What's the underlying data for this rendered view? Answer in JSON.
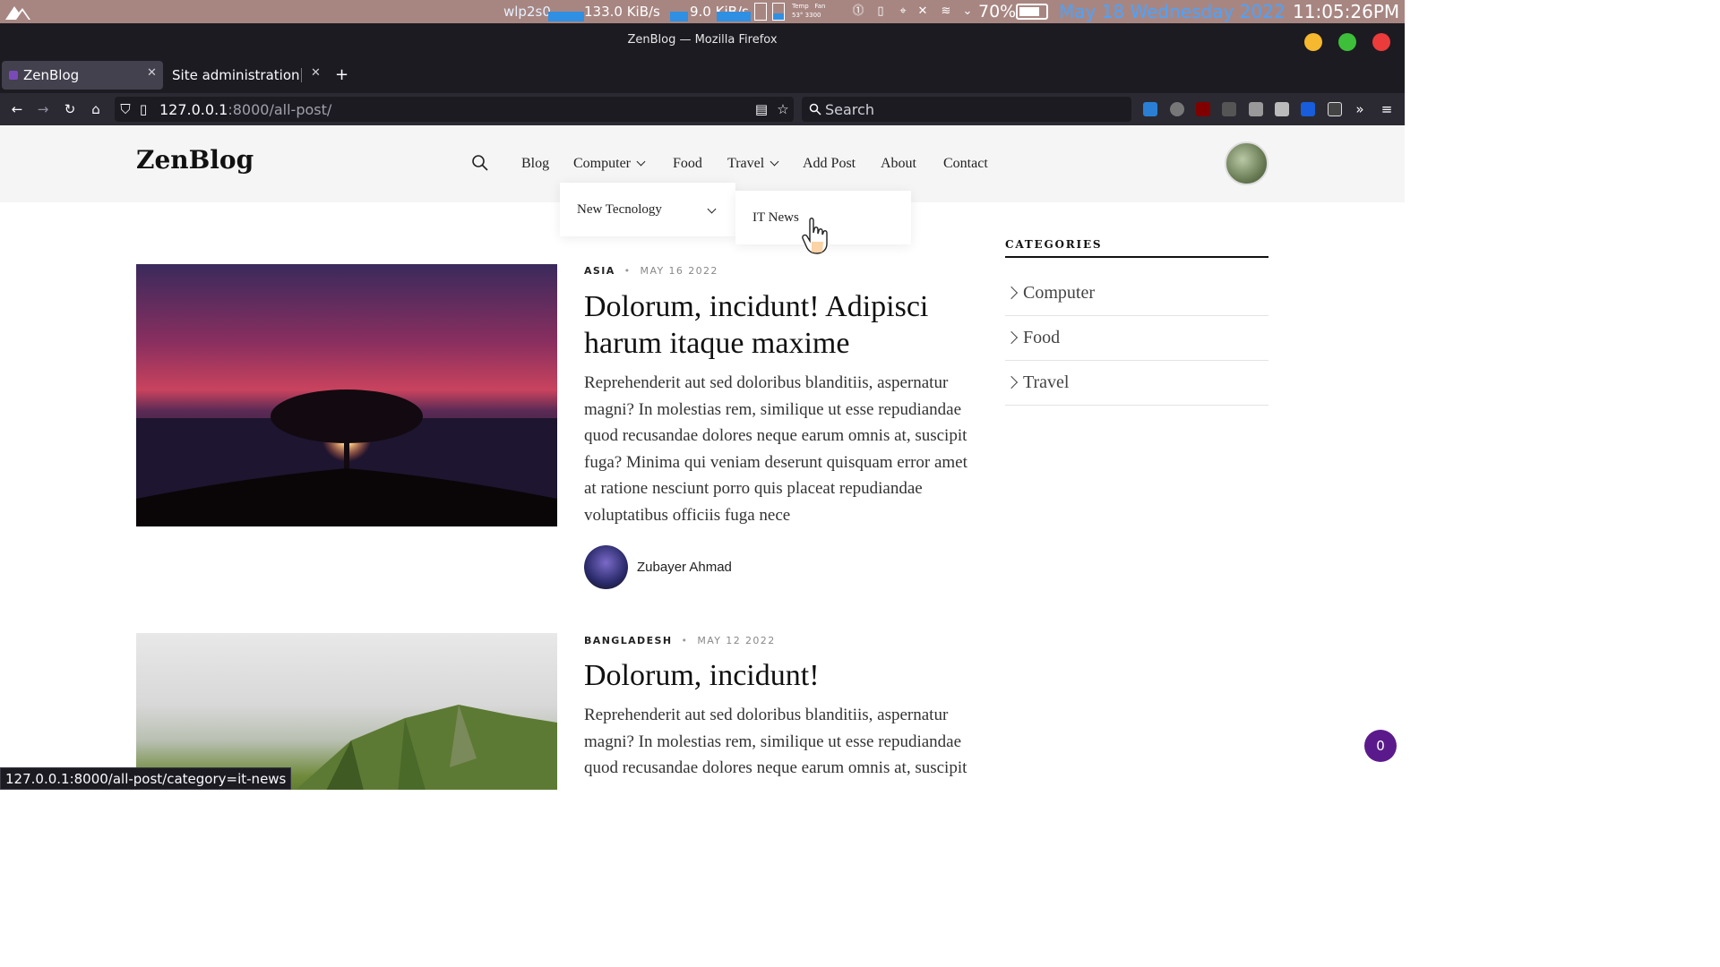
{
  "system": {
    "network_iface": "wlp2s0",
    "download": "133.0 KiB/s",
    "upload": "9.0 KiB/s",
    "temp_label": "Temp",
    "temp_value": "53°",
    "fan_label": "Fan",
    "fan_value": "3300",
    "battery_pct": "70%",
    "date": "May 18 Wednesday 2022",
    "time": "11:05:26PM"
  },
  "window": {
    "title": "ZenBlog — Mozilla Firefox"
  },
  "tabs": [
    {
      "label": "ZenBlog",
      "active": true
    },
    {
      "label": "Site administration"
    }
  ],
  "urlbar": {
    "host": "127.0.0.1",
    "path": ":8000/all-post/"
  },
  "searchbar": {
    "placeholder": "Search"
  },
  "site": {
    "brand": "ZenBlog",
    "nav": {
      "blog": "Blog",
      "computer": "Computer",
      "food": "Food",
      "travel": "Travel",
      "add_post": "Add Post",
      "about": "About",
      "contact": "Contact"
    },
    "dropdown": {
      "item": "New Tecnology",
      "submenu_item": "IT News"
    }
  },
  "posts": [
    {
      "category": "ASIA",
      "date": "MAY 16 2022",
      "title": "Dolorum, incidunt! Adipisci harum itaque maxime",
      "excerpt": "Reprehenderit aut sed doloribus blanditiis, aspernatur magni? In molestias rem, similique ut esse repudiandae quod recusandae dolores neque earum omnis at, suscipit fuga? Minima qui veniam deserunt quisquam error amet at ratione nesciunt porro quis placeat repudiandae voluptatibus officiis fuga nece",
      "author": "Zubayer Ahmad"
    },
    {
      "category": "BANGLADESH",
      "date": "MAY 12 2022",
      "title": "Dolorum, incidunt!",
      "excerpt": "Reprehenderit aut sed doloribus blanditiis, aspernatur magni? In molestias rem, similique ut esse repudiandae quod recusandae dolores neque earum omnis at, suscipit"
    }
  ],
  "sidebar": {
    "title": "CATEGORIES",
    "categories": [
      "Computer",
      "Food",
      "Travel"
    ]
  },
  "status_url": "127.0.0.1:8000/all-post/category=it-news",
  "chat_count": "0",
  "colors": {
    "system_bar": "#a78682",
    "chrome_dark": "#1c1b22",
    "toolbar": "#2b2a33",
    "chat_badge": "#5b1a8c",
    "date_blue": "#4aa3ff"
  },
  "icons": [
    "arch-logo-icon",
    "back-icon",
    "forward-icon",
    "reload-icon",
    "home-icon",
    "shield-icon",
    "page-icon",
    "reader-view-icon",
    "bookmark-star-icon",
    "search-icon",
    "menu-icon",
    "chevron-down-icon",
    "chevron-right-icon",
    "hand-cursor-icon"
  ]
}
